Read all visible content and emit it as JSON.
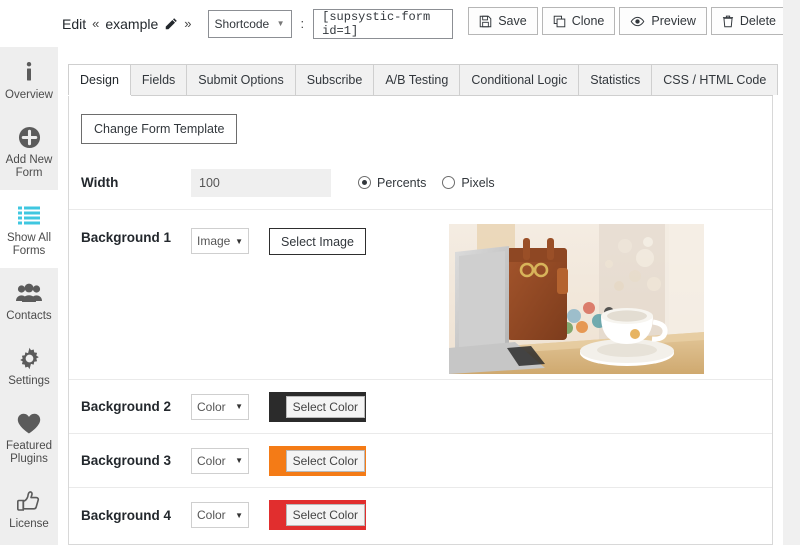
{
  "topbar": {
    "edit_label": "Edit",
    "open_quote": "«",
    "form_name": "example",
    "close_quote": "»",
    "pencil_icon": "pencil-icon",
    "shortcode_select": "Shortcode",
    "separator": ":",
    "shortcode_value": "[supsystic-form id=1]",
    "buttons": [
      {
        "label": "Save",
        "icon": "save-icon"
      },
      {
        "label": "Clone",
        "icon": "clone-icon"
      },
      {
        "label": "Preview",
        "icon": "eye-icon"
      },
      {
        "label": "Delete",
        "icon": "trash-icon"
      }
    ]
  },
  "sidebar": {
    "items": [
      {
        "label": "Overview",
        "icon": "info-icon",
        "active": false
      },
      {
        "label": "Add New Form",
        "icon": "plus-circle-icon",
        "active": false
      },
      {
        "label": "Show All Forms",
        "icon": "list-icon",
        "active": true
      },
      {
        "label": "Contacts",
        "icon": "people-icon",
        "active": false
      },
      {
        "label": "Settings",
        "icon": "gear-icon",
        "active": false
      },
      {
        "label": "Featured Plugins",
        "icon": "heart-icon",
        "active": false
      },
      {
        "label": "License",
        "icon": "thumbs-up-icon",
        "active": false
      }
    ],
    "active_color": "#3fc7e0"
  },
  "tabs": [
    {
      "label": "Design",
      "active": true
    },
    {
      "label": "Fields",
      "active": false
    },
    {
      "label": "Submit Options",
      "active": false
    },
    {
      "label": "Subscribe",
      "active": false
    },
    {
      "label": "A/B Testing",
      "active": false
    },
    {
      "label": "Conditional Logic",
      "active": false
    },
    {
      "label": "Statistics",
      "active": false
    },
    {
      "label": "CSS / HTML Code",
      "active": false
    }
  ],
  "design": {
    "change_template_label": "Change Form Template",
    "width": {
      "label": "Width",
      "value": "100",
      "placeholder": "",
      "units": [
        {
          "label": "Percents",
          "selected": true
        },
        {
          "label": "Pixels",
          "selected": false
        }
      ]
    },
    "backgrounds": [
      {
        "label": "Background 1",
        "type": "Image",
        "action_label": "Select Image",
        "action_kind": "image",
        "color": "",
        "preview_alt": "laptop leather bag and coffee cup on wooden desk"
      },
      {
        "label": "Background 2",
        "type": "Color",
        "action_label": "Select Color",
        "action_kind": "color",
        "color": "#2b2b2b"
      },
      {
        "label": "Background 3",
        "type": "Color",
        "action_label": "Select Color",
        "action_kind": "color",
        "color": "#f47b16"
      },
      {
        "label": "Background 4",
        "type": "Color",
        "action_label": "Select Color",
        "action_kind": "color",
        "color": "#e12e2e"
      }
    ]
  }
}
